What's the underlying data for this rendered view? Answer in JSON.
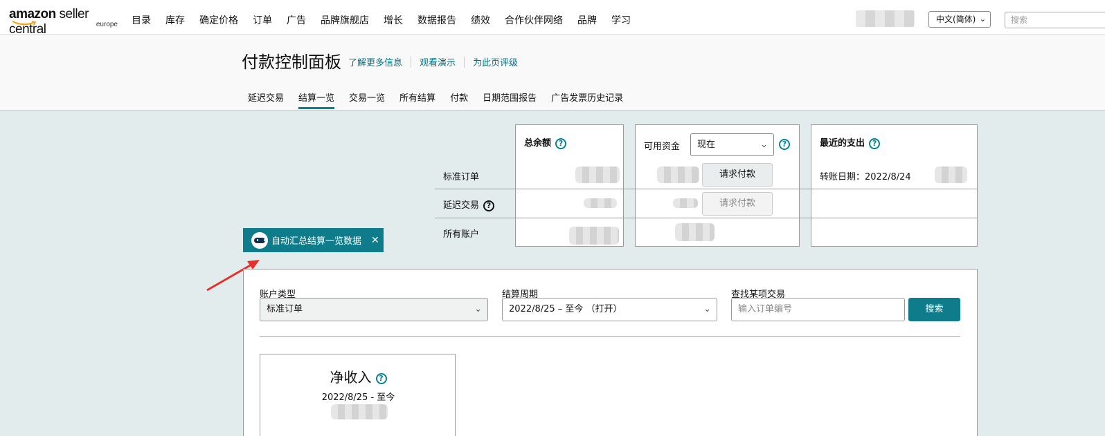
{
  "logo": {
    "brand_amazon": "amazon",
    "brand_sc": " seller central",
    "region": "europe"
  },
  "nav": [
    "目录",
    "库存",
    "确定价格",
    "订单",
    "广告",
    "品牌旗舰店",
    "增长",
    "数据报告",
    "绩效",
    "合作伙伴网络",
    "品牌",
    "学习"
  ],
  "language": "中文(简体)",
  "search_placeholder": "搜索",
  "page": {
    "title": "付款控制面板",
    "links": [
      "了解更多信息",
      "观看演示",
      "为此页评级"
    ]
  },
  "tabs": [
    {
      "label": "延迟交易",
      "active": false
    },
    {
      "label": "结算一览",
      "active": true
    },
    {
      "label": "交易一览",
      "active": false
    },
    {
      "label": "所有结算",
      "active": false
    },
    {
      "label": "付款",
      "active": false
    },
    {
      "label": "日期范围报告",
      "active": false
    },
    {
      "label": "广告发票历史记录",
      "active": false
    }
  ],
  "summary": {
    "total_balance": "总余额",
    "available_funds": "可用资金",
    "available_period": "现在",
    "recent_payout": "最近的支出",
    "row_standard": "标准订单",
    "row_deferred": "延迟交易",
    "row_all": "所有账户",
    "request_payment": "请求付款",
    "transfer_date": "转账日期：2022/8/24"
  },
  "tool_badge": {
    "label": "自动汇总结算一览数据",
    "close": "✕"
  },
  "filters": {
    "account_type_label": "账户类型",
    "account_type_value": "标准订单",
    "period_label": "结算周期",
    "period_value": "2022/8/25 – 至今 （打开）",
    "find_label": "查找某项交易",
    "find_placeholder": "输入订单编号",
    "search_button": "搜索"
  },
  "net_income": {
    "title": "净收入",
    "date": "2022/8/25 - 至今"
  },
  "colors": {
    "accent": "#0f7c8c",
    "link": "#007185",
    "background": "#e3ecec",
    "arrow": "#e8302a"
  }
}
